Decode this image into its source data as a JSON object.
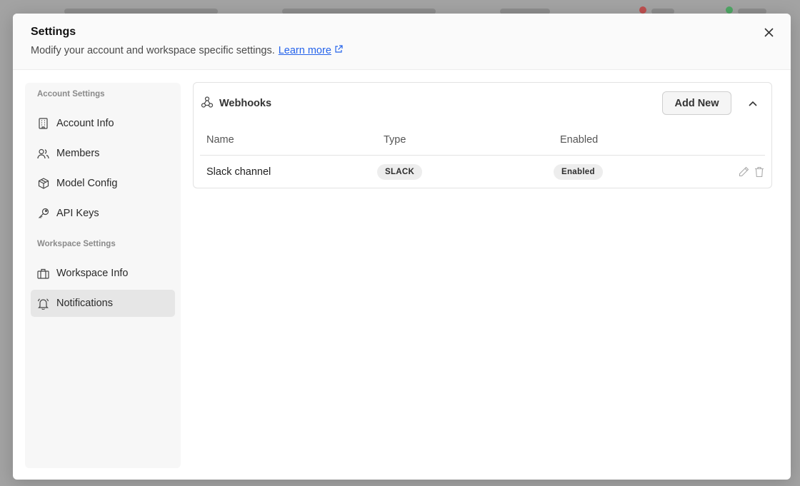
{
  "modal": {
    "title": "Settings",
    "subtitle": "Modify your account and workspace specific settings.",
    "learn_more": "Learn more"
  },
  "sidebar": {
    "account_section": "Account Settings",
    "account_items": [
      {
        "label": "Account Info",
        "icon": "building-icon"
      },
      {
        "label": "Members",
        "icon": "users-icon"
      },
      {
        "label": "Model Config",
        "icon": "cube-icon"
      },
      {
        "label": "API Keys",
        "icon": "key-icon"
      }
    ],
    "workspace_section": "Workspace Settings",
    "workspace_items": [
      {
        "label": "Workspace Info",
        "icon": "briefcase-icon"
      },
      {
        "label": "Notifications",
        "icon": "bell-icon",
        "active": true
      }
    ]
  },
  "webhooks": {
    "title": "Webhooks",
    "add_label": "Add New",
    "columns": [
      "Name",
      "Type",
      "Enabled"
    ],
    "rows": [
      {
        "name": "Slack channel",
        "type": "SLACK",
        "enabled": "Enabled"
      }
    ]
  },
  "colors": {
    "link": "#2563eb",
    "active_nav": "#e6e6e6",
    "badge_bg": "#ededed"
  }
}
